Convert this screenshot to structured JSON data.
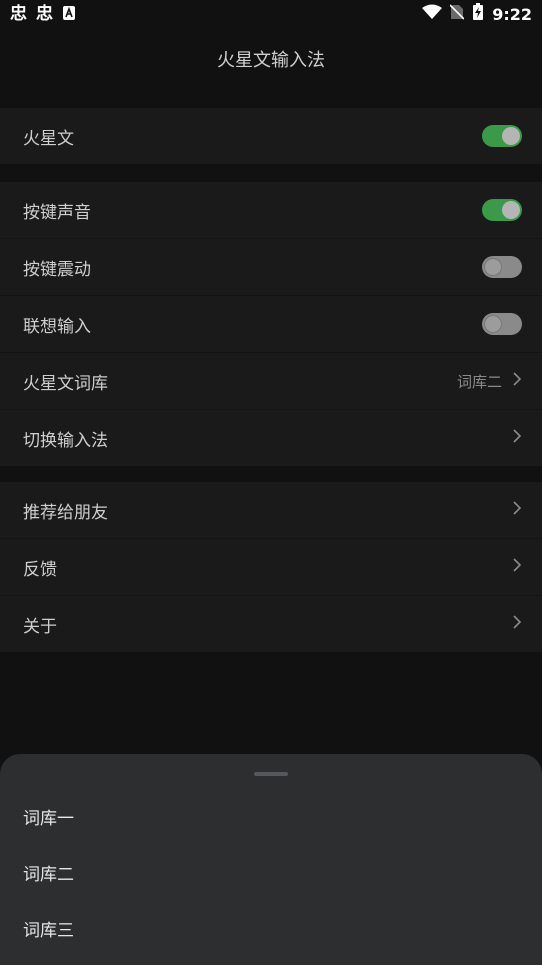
{
  "status_bar": {
    "time": "9:22",
    "left_icons": [
      "app-notification-icon",
      "app-notification-icon",
      "text-notification-icon"
    ],
    "right_icons": [
      "wifi-icon",
      "no-sim-icon",
      "battery-charging-icon"
    ]
  },
  "header": {
    "title": "火星文输入法"
  },
  "groups": [
    {
      "items": [
        {
          "label": "火星文",
          "control": "toggle",
          "on": true
        }
      ]
    },
    {
      "items": [
        {
          "label": "按键声音",
          "control": "toggle",
          "on": true
        },
        {
          "label": "按键震动",
          "control": "toggle",
          "on": false
        },
        {
          "label": "联想输入",
          "control": "toggle",
          "on": false
        },
        {
          "label": "火星文词库",
          "control": "chevron",
          "value": "词库二"
        },
        {
          "label": "切换输入法",
          "control": "chevron"
        }
      ]
    },
    {
      "items": [
        {
          "label": "推荐给朋友",
          "control": "chevron"
        },
        {
          "label": "反馈",
          "control": "chevron"
        },
        {
          "label": "关于",
          "control": "chevron"
        }
      ]
    }
  ],
  "bottom_sheet": {
    "options": [
      "词库一",
      "词库二",
      "词库三"
    ]
  },
  "colors": {
    "background": "#111111",
    "row_background": "#1a1a1a",
    "toggle_on": "#3a9a4a",
    "toggle_off": "#8a8a8a",
    "sheet_background": "#2d2e30"
  }
}
